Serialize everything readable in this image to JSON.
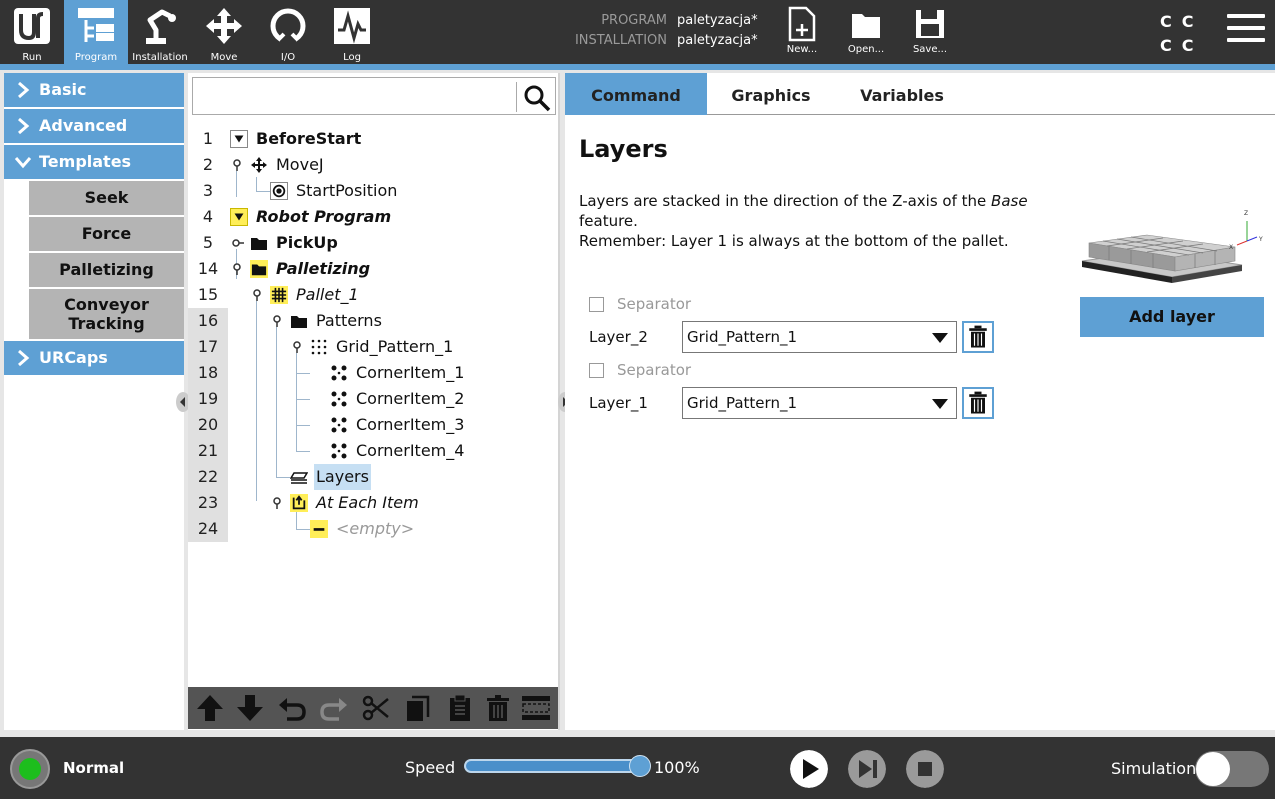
{
  "topbar": {
    "nav": [
      {
        "label": "Run",
        "icon": "ur-logo-icon"
      },
      {
        "label": "Program",
        "icon": "program-icon"
      },
      {
        "label": "Installation",
        "icon": "installation-icon"
      },
      {
        "label": "Move",
        "icon": "move-icon"
      },
      {
        "label": "I/O",
        "icon": "io-icon"
      },
      {
        "label": "Log",
        "icon": "log-icon"
      }
    ],
    "program_label": "PROGRAM",
    "program_value": "paletyzacja*",
    "installation_label": "INSTALLATION",
    "installation_value": "paletyzacja*",
    "file": [
      {
        "label": "New...",
        "icon": "new-file-icon"
      },
      {
        "label": "Open...",
        "icon": "open-folder-icon"
      },
      {
        "label": "Save...",
        "icon": "save-icon"
      }
    ],
    "cc": [
      "C",
      "C",
      "C",
      "C"
    ]
  },
  "sidebar": {
    "categories": [
      "Basic",
      "Advanced",
      "Templates",
      "URCaps"
    ],
    "templates": [
      "Seek",
      "Force",
      "Palletizing",
      "Conveyor Tracking"
    ]
  },
  "tree": {
    "lines": [
      "1",
      "2",
      "3",
      "4",
      "5",
      "14",
      "15",
      "16",
      "17",
      "18",
      "19",
      "20",
      "21",
      "22",
      "23",
      "24"
    ],
    "nodes": {
      "before_start": "BeforeStart",
      "movej": "MoveJ",
      "start_position": "StartPosition",
      "robot_program": "Robot Program",
      "pickup": "PickUp",
      "palletizing": "Palletizing",
      "pallet_1": "Pallet_1",
      "patterns": "Patterns",
      "grid_pattern_1": "Grid_Pattern_1",
      "corner_1": "CornerItem_1",
      "corner_2": "CornerItem_2",
      "corner_3": "CornerItem_3",
      "corner_4": "CornerItem_4",
      "layers": "Layers",
      "at_each_item": "At Each Item",
      "empty": "<empty>"
    }
  },
  "command": {
    "tabs": [
      "Command",
      "Graphics",
      "Variables"
    ],
    "title": "Layers",
    "desc_1": "Layers are stacked in the direction of the Z-axis of the",
    "desc_base": "Base",
    "desc_2": "feature.",
    "desc_3": "Remember: Layer 1 is always at the bottom of the pallet.",
    "separator_label": "Separator",
    "layers": [
      {
        "name": "Layer_2",
        "pattern": "Grid_Pattern_1"
      },
      {
        "name": "Layer_1",
        "pattern": "Grid_Pattern_1"
      }
    ],
    "add_layer": "Add layer",
    "axis_labels": {
      "z": "Z",
      "x": "X",
      "y": "Y"
    }
  },
  "bottombar": {
    "status": "Normal",
    "status_color": "#1dbe1d",
    "speed_label": "Speed",
    "speed_value": "100%",
    "speed_fraction": 1.0,
    "simulation_label": "Simulation",
    "simulation_on": false
  },
  "colors": {
    "accent": "#5ea0d4",
    "bar": "#333333"
  }
}
